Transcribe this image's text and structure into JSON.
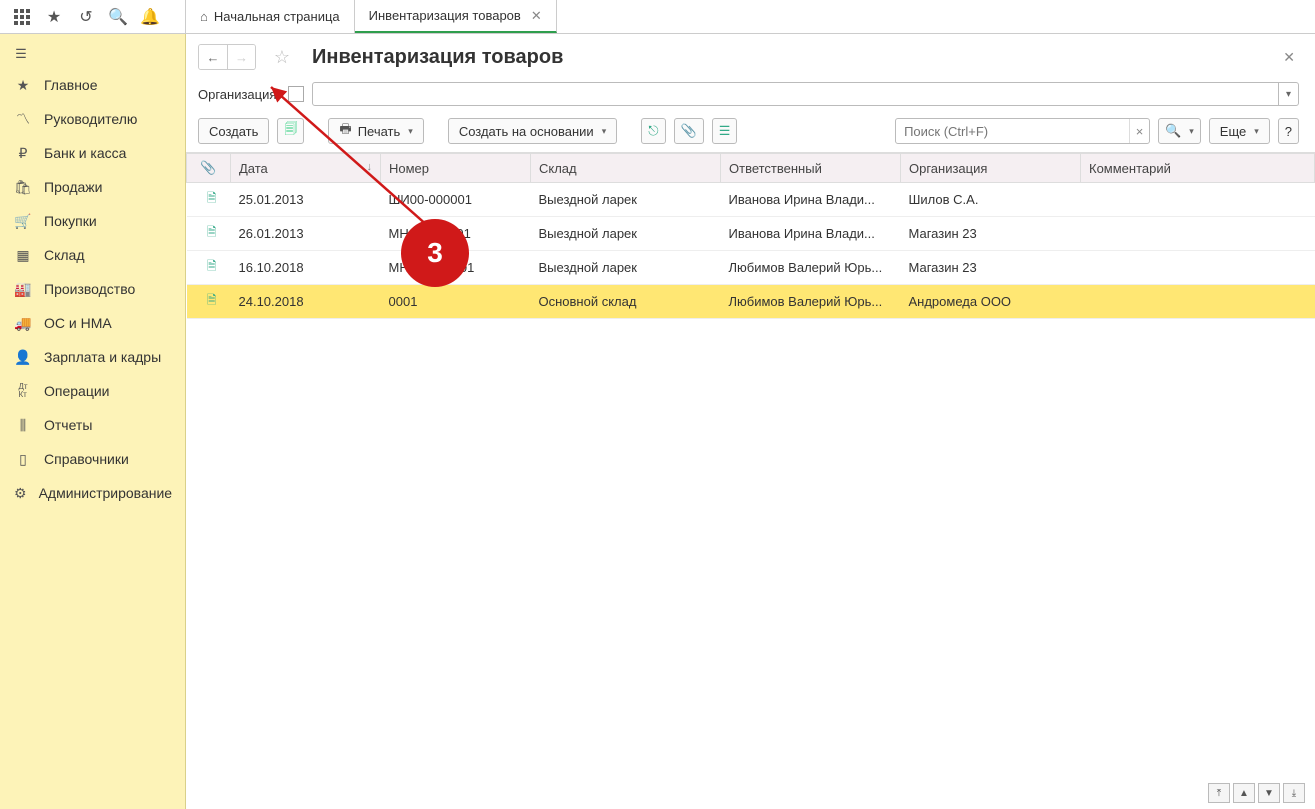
{
  "tabs": {
    "home": "Начальная страница",
    "inventory": "Инвентаризация товаров"
  },
  "sidebar": {
    "items": [
      {
        "label": "Главное",
        "icon": "★"
      },
      {
        "label": "Руководителю",
        "icon": "↗"
      },
      {
        "label": "Банк и касса",
        "icon": "₽"
      },
      {
        "label": "Продажи",
        "icon": "🛍"
      },
      {
        "label": "Покупки",
        "icon": "🛒"
      },
      {
        "label": "Склад",
        "icon": "▦"
      },
      {
        "label": "Производство",
        "icon": "🏭"
      },
      {
        "label": "ОС и НМА",
        "icon": "🚚"
      },
      {
        "label": "Зарплата и кадры",
        "icon": "👤"
      },
      {
        "label": "Операции",
        "icon": "Дт/Кт"
      },
      {
        "label": "Отчеты",
        "icon": "⫼"
      },
      {
        "label": "Справочники",
        "icon": "▯"
      },
      {
        "label": "Администрирование",
        "icon": "⚙"
      }
    ]
  },
  "page": {
    "title": "Инвентаризация товаров"
  },
  "org": {
    "label": "Организация:"
  },
  "toolbar": {
    "create": "Создать",
    "print": "Печать",
    "create_based": "Создать на основании",
    "more": "Еще",
    "help": "?",
    "search_placeholder": "Поиск (Ctrl+F)"
  },
  "columns": {
    "date": "Дата",
    "number": "Номер",
    "sklad": "Склад",
    "responsible": "Ответственный",
    "org": "Организация",
    "comment": "Комментарий"
  },
  "rows": [
    {
      "date": "25.01.2013",
      "number": "ШИ00-000001",
      "sklad": "Выездной ларек",
      "resp": "Иванова Ирина Влади...",
      "org": "Шилов С.А.",
      "comment": ""
    },
    {
      "date": "26.01.2013",
      "number": "МН00-000001",
      "sklad": "Выездной ларек",
      "resp": "Иванова Ирина Влади...",
      "org": "Магазин 23",
      "comment": ""
    },
    {
      "date": "16.10.2018",
      "number": "МНБП-000001",
      "sklad": "Выездной ларек",
      "resp": "Любимов Валерий Юрь...",
      "org": "Магазин 23",
      "comment": ""
    },
    {
      "date": "24.10.2018",
      "number": "0001",
      "sklad": "Основной склад",
      "resp": "Любимов Валерий Юрь...",
      "org": "Андромеда ООО",
      "comment": "",
      "selected": true
    }
  ],
  "annotation": {
    "badge": "3"
  }
}
